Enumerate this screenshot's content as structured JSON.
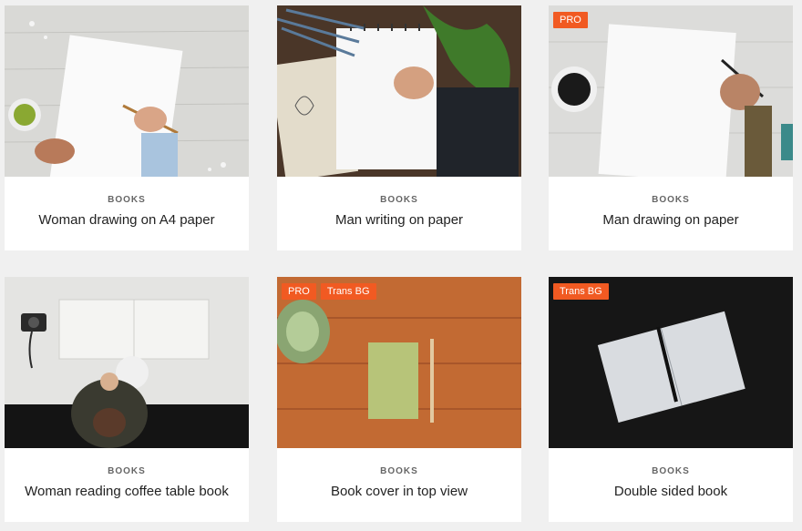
{
  "cards": [
    {
      "category": "BOOKS",
      "title": "Woman drawing on A4 paper",
      "badges": []
    },
    {
      "category": "BOOKS",
      "title": "Man writing on paper",
      "badges": []
    },
    {
      "category": "BOOKS",
      "title": "Man drawing on paper",
      "badges": [
        "PRO"
      ]
    },
    {
      "category": "BOOKS",
      "title": "Woman reading coffee table book",
      "badges": []
    },
    {
      "category": "BOOKS",
      "title": "Book cover in top view",
      "badges": [
        "PRO",
        "Trans BG"
      ]
    },
    {
      "category": "BOOKS",
      "title": "Double sided book",
      "badges": [
        "Trans BG"
      ]
    }
  ],
  "colors": {
    "badge": "#f15a22",
    "background": "#f0f0f0",
    "card": "#ffffff"
  }
}
